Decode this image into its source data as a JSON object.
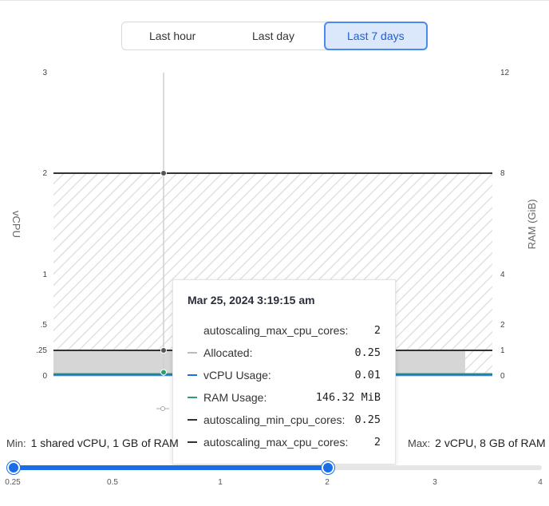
{
  "range_tabs": {
    "items": [
      "Last hour",
      "Last day",
      "Last 7 days"
    ],
    "active": "Last 7 days",
    "active_color": "#4a8bf0"
  },
  "chart_data": {
    "type": "line",
    "y_left": {
      "label": "vCPU",
      "ticks": [
        "0",
        ".25",
        ".5",
        "1",
        "2",
        "3"
      ],
      "ylim": [
        0,
        3
      ]
    },
    "y_right": {
      "label": "RAM (GiB)",
      "ticks": [
        "0",
        "1",
        "2",
        "4",
        "8",
        "12"
      ],
      "ylim": [
        0,
        12
      ]
    },
    "series": [
      {
        "name": "autoscaling_max_cpu_cores",
        "values": [
          2,
          2
        ],
        "color": "#333333"
      },
      {
        "name": "Allocated",
        "values": [
          0.25,
          0.25
        ],
        "color": "#bbbbbb"
      },
      {
        "name": "vCPU Usage",
        "values": [
          0.01,
          0.01
        ],
        "color": "#1f6fe0"
      },
      {
        "name": "RAM Usage",
        "values": [
          0.02,
          0.02
        ],
        "color": "#2e9e6e"
      },
      {
        "name": "autoscaling_min_cpu_cores",
        "values": [
          0.25,
          0.25
        ],
        "color": "#333333"
      }
    ],
    "grid": false
  },
  "tooltip": {
    "time": "Mar 25, 2024 3:19:15 am",
    "rows": [
      {
        "label": "autoscaling_max_cpu_cores:",
        "value": "2",
        "color": ""
      },
      {
        "label": "Allocated:",
        "value": "0.25",
        "color": "#bbbbbb"
      },
      {
        "label": "vCPU Usage:",
        "value": "0.01",
        "color": "#1f6fe0"
      },
      {
        "label": "RAM Usage:",
        "value": "146.32 MiB",
        "color": "#2e9e6e"
      },
      {
        "label": "autoscaling_min_cpu_cores:",
        "value": "0.25",
        "color": "#333333"
      },
      {
        "label": "autoscaling_max_cpu_cores:",
        "value": "2",
        "color": "#333333"
      }
    ]
  },
  "compute_range": {
    "min_key": "Min:",
    "min_value": "1 shared vCPU, 1 GB of RAM",
    "max_key": "Max:",
    "max_value": "2 vCPU, 8 GB of RAM",
    "ticks": [
      "0.25",
      "0.5",
      "1",
      "2",
      "3",
      "4"
    ],
    "selected_min": "0.25",
    "selected_max": "2",
    "accent": "#1a6de6"
  }
}
